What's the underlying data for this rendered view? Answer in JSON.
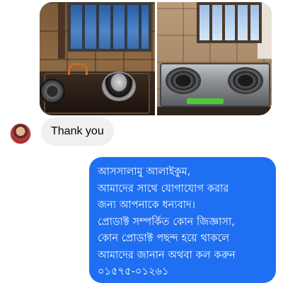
{
  "photos": [
    {
      "icon": "stove-photo-before"
    },
    {
      "icon": "stove-photo-after"
    }
  ],
  "incoming_message": {
    "text": "Thank you",
    "avatar": "user-avatar"
  },
  "outgoing_message": {
    "lines": [
      "আসসালামু আলাইকুম,",
      "আমাদের সাথে যোগাযোগ করার",
      "জন্য আপনাকে  ধন্যবাদ।",
      "প্রোডাক্ট সম্পর্কিত কোন জিজ্ঞাসা,",
      "কোন প্রোডাক্ট পছন্দ হয়ে থাকলে",
      "আমাদের জানান অথবা কল করুন",
      "০১৫৭৫-০১২৬১"
    ]
  },
  "colors": {
    "outgoing_bubble": "#1f6ff2",
    "incoming_bubble": "#f0f0f0"
  }
}
